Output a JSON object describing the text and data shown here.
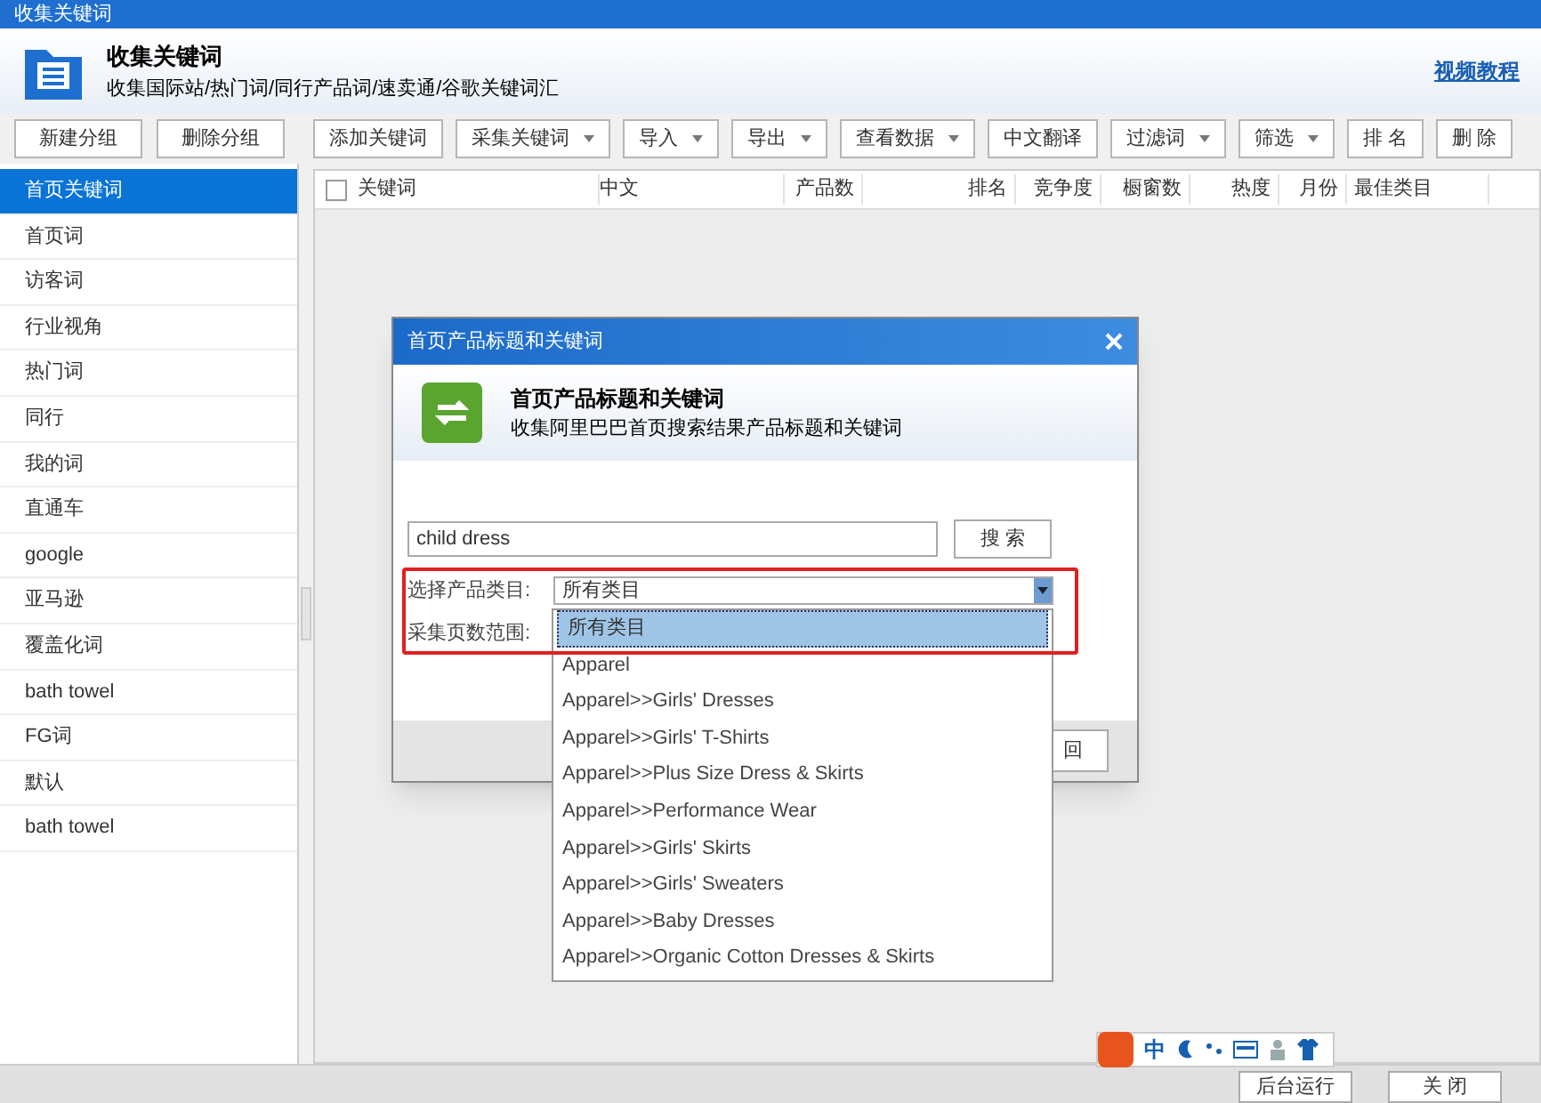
{
  "window": {
    "title": "收集关键词"
  },
  "header": {
    "title": "收集关键词",
    "subtitle": "收集国际站/热门词/同行产品词/速卖通/谷歌关键词汇",
    "link": "视频教程"
  },
  "sidebar_buttons": [
    "新建分组",
    "删除分组"
  ],
  "toolbar": [
    {
      "label": "添加关键词",
      "kind": "button"
    },
    {
      "label": "采集关键词",
      "kind": "dropdown"
    },
    {
      "label": "导入",
      "kind": "dropdown"
    },
    {
      "label": "导出",
      "kind": "dropdown"
    },
    {
      "label": "查看数据",
      "kind": "dropdown"
    },
    {
      "label": "中文翻译",
      "kind": "button"
    },
    {
      "label": "过滤词",
      "kind": "dropdown"
    },
    {
      "label": "筛选",
      "kind": "dropdown"
    },
    {
      "label": "排 名",
      "kind": "button"
    },
    {
      "label": "删 除",
      "kind": "button"
    }
  ],
  "sidebar": {
    "items": [
      {
        "label": "首页关键词",
        "selected": true
      },
      {
        "label": "首页词",
        "selected": false
      },
      {
        "label": "访客词",
        "selected": false
      },
      {
        "label": "行业视角",
        "selected": false
      },
      {
        "label": "热门词",
        "selected": false
      },
      {
        "label": "同行",
        "selected": false
      },
      {
        "label": "我的词",
        "selected": false
      },
      {
        "label": "直通车",
        "selected": false
      },
      {
        "label": "google",
        "selected": false
      },
      {
        "label": "亚马逊",
        "selected": false
      },
      {
        "label": "覆盖化词",
        "selected": false
      },
      {
        "label": "bath towel",
        "selected": false
      },
      {
        "label": "FG词",
        "selected": false
      },
      {
        "label": "默认",
        "selected": false
      },
      {
        "label": "bath towel",
        "selected": false
      }
    ]
  },
  "table": {
    "select_all_checked": false,
    "columns": [
      "关键词",
      "中文",
      "产品数",
      "排名",
      "竞争度",
      "橱窗数",
      "热度",
      "月份",
      "最佳类目"
    ]
  },
  "dialog": {
    "title": "首页产品标题和关键词",
    "heading": "首页产品标题和关键词",
    "description": "收集阿里巴巴首页搜索结果产品标题和关键词",
    "search_value": "child dress",
    "search_button": "搜 索",
    "category_label": "选择产品类目:",
    "category_value": "所有类目",
    "pages_label": "采集页数范围:",
    "footer_button": "回",
    "options": [
      {
        "label": "所有类目",
        "selected": true
      },
      {
        "label": "Apparel",
        "selected": false
      },
      {
        "label": "Apparel>>Girls' Dresses",
        "selected": false
      },
      {
        "label": "Apparel>>Girls' T-Shirts",
        "selected": false
      },
      {
        "label": "Apparel>>Plus Size Dress & Skirts",
        "selected": false
      },
      {
        "label": "Apparel>>Performance Wear",
        "selected": false
      },
      {
        "label": "Apparel>>Girls' Skirts",
        "selected": false
      },
      {
        "label": "Apparel>>Girls' Sweaters",
        "selected": false
      },
      {
        "label": "Apparel>>Baby Dresses",
        "selected": false
      },
      {
        "label": "Apparel>>Organic Cotton Dresses & Skirts",
        "selected": false
      }
    ]
  },
  "ime_bar": {
    "mode": "中"
  },
  "bottom_buttons": [
    "后台运行",
    "关 闭"
  ]
}
